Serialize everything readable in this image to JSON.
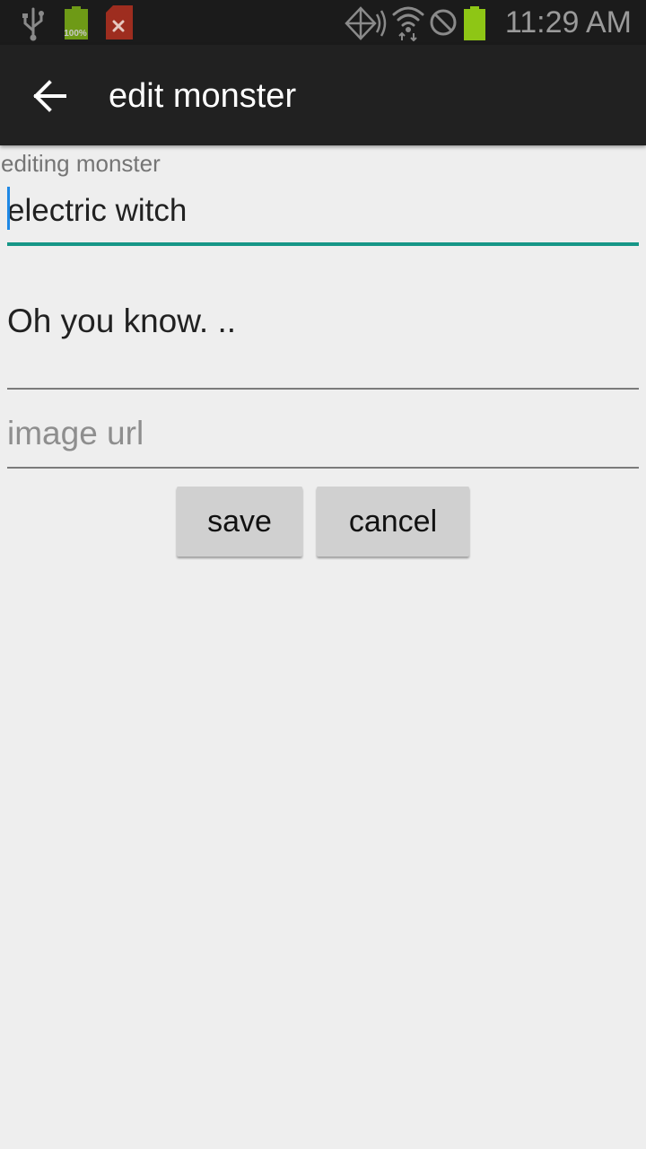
{
  "status_bar": {
    "time": "11:29 AM",
    "battery_percent_label": "100%",
    "icons": [
      "usb-icon",
      "battery-full-icon",
      "storage-error-icon",
      "nfc-icon",
      "wifi-icon",
      "do-not-disturb-icon",
      "battery-icon"
    ],
    "battery_color": "#8ec615",
    "error_icon_color": "#b3301f"
  },
  "app_bar": {
    "title": "edit monster",
    "back_icon": "arrow-back-icon"
  },
  "form": {
    "name_label": "editing monster",
    "name_value": "electric witch",
    "description_value": "Oh you know. ..",
    "image_url_value": "",
    "image_url_placeholder": "image url"
  },
  "buttons": {
    "save_label": "save",
    "cancel_label": "cancel"
  },
  "colors": {
    "accent_underline": "#169687",
    "cursor": "#1e88e5",
    "app_bar_bg": "#212121",
    "background": "#eeeeee"
  }
}
